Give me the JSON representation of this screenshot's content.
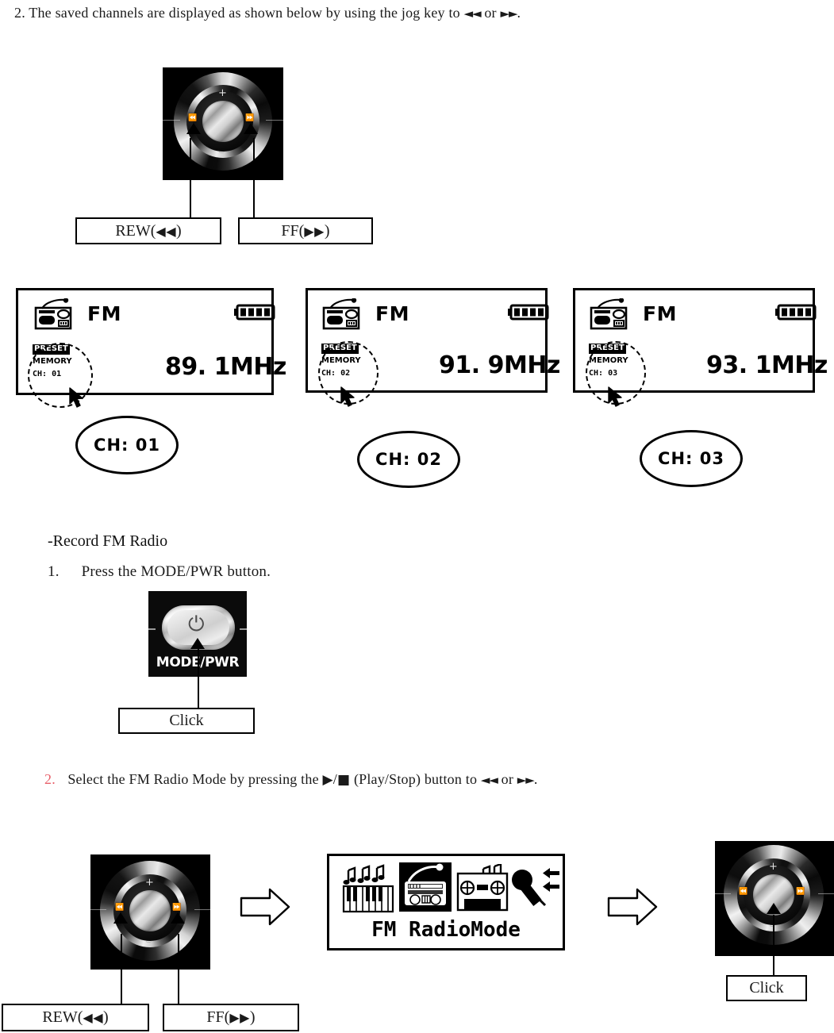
{
  "page": {
    "step2_top": {
      "number": "2.",
      "text_a": "The saved channels are displayed as shown below by using the jog key to",
      "rew_symbol": "◄◄",
      "or_text": "or",
      "ff_symbol": "►►",
      "period": "."
    },
    "jog_callouts_top": {
      "rew_label": "REW(",
      "rew_arrows": "◀◀",
      "rew_close": ")",
      "ff_label": "FF(",
      "ff_arrows": "▶▶",
      "ff_close": ")"
    },
    "jog_dial": {
      "plus_label": "+",
      "minus_label": "–",
      "rew_glyph": "⏪",
      "ff_glyph": "⏩"
    },
    "lcd_screens": [
      {
        "mode_label": "FM",
        "radio_icon": "radio-icon",
        "battery_icon": "battery-full-icon",
        "preset_tag": "PRESET",
        "memory_label": "MEMORY",
        "channel_label": "CH: 01",
        "frequency": "89. 1MHz",
        "callout_text": "CH: 01"
      },
      {
        "mode_label": "FM",
        "radio_icon": "radio-icon",
        "battery_icon": "battery-full-icon",
        "preset_tag": "PRESET",
        "memory_label": "MEMORY",
        "channel_label": "CH: 02",
        "frequency": "91. 9MHz",
        "callout_text": "CH: 02"
      },
      {
        "mode_label": "FM",
        "radio_icon": "radio-icon",
        "battery_icon": "battery-full-icon",
        "preset_tag": "PRESET",
        "memory_label": "MEMORY",
        "channel_label": "CH: 03",
        "frequency": "93. 1MHz",
        "callout_text": "CH: 03"
      }
    ],
    "record_section": {
      "heading": "-Record FM Radio",
      "step1": {
        "number": "1.",
        "text": "Press the MODE/PWR button."
      },
      "modepwr_button": {
        "label": "MODE/PWR",
        "power_glyph": "⏻"
      },
      "click_callout": "Click",
      "step2": {
        "number": "2.",
        "text_a": "Select the FM Radio Mode by pressing the",
        "play_symbol": "▶",
        "slash": "/",
        "stop_symbol": "■",
        "text_b": "(Play/Stop) button to",
        "rew_symbol": "◄◄",
        "or_text": "or",
        "ff_symbol": "►►",
        "period": "."
      }
    },
    "mode_panel": {
      "label": "FM RadioMode",
      "icons": [
        "music-piano-icon",
        "radio-icon-selected",
        "cassette-icon",
        "microphone-icon"
      ]
    },
    "jog_callouts_bottom": {
      "rew_label": "REW(",
      "rew_arrows": "◀◀",
      "rew_close": ")",
      "ff_label": "FF(",
      "ff_arrows": "▶▶",
      "ff_close": ")",
      "click_label": "Click"
    },
    "colors": {
      "accent_red": "#e8606a",
      "ink": "#000000",
      "paper": "#ffffff"
    }
  }
}
